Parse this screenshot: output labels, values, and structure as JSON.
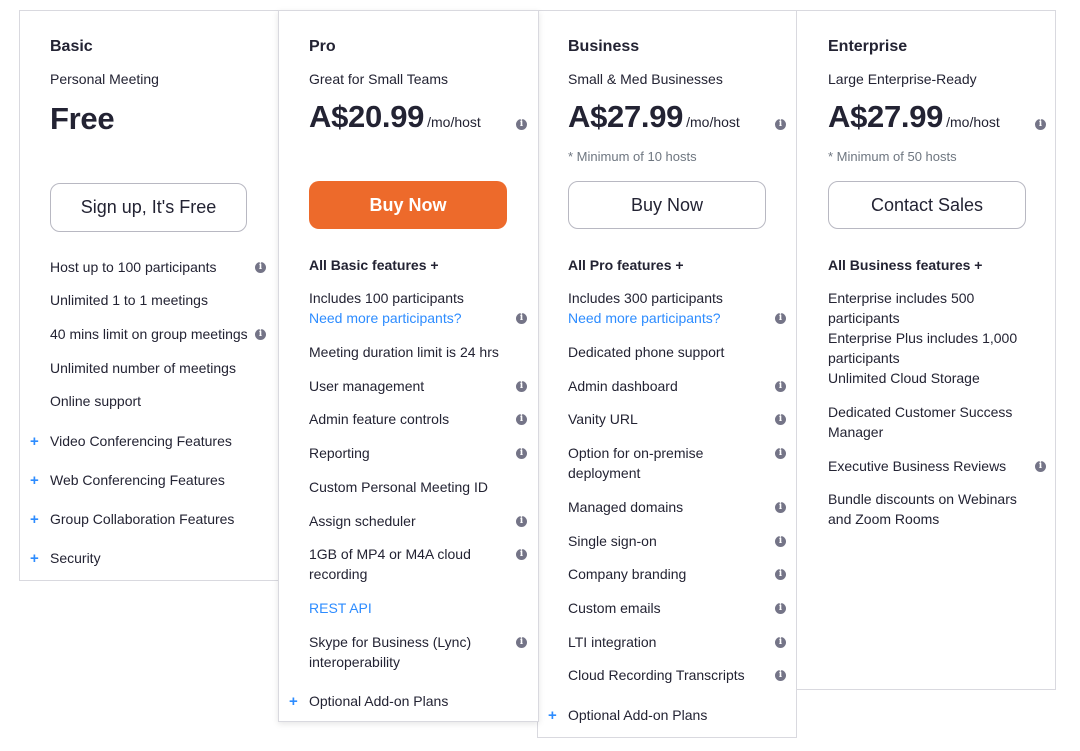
{
  "plans": {
    "basic": {
      "name": "Basic",
      "tagline": "Personal Meeting",
      "price": "Free",
      "button": "Sign up, It's Free",
      "features": [
        "Host up to 100 participants",
        "Unlimited 1 to 1 meetings",
        "40 mins limit on group meetings",
        "Unlimited number of meetings",
        "Online support"
      ],
      "expandables": [
        "Video Conferencing Features",
        "Web Conferencing Features",
        "Group Collaboration Features",
        "Security"
      ]
    },
    "pro": {
      "name": "Pro",
      "tagline": "Great for Small Teams",
      "price": "A$20.99",
      "price_unit": "/mo/host",
      "button": "Buy Now",
      "features_header": "All Basic features +",
      "features": {
        "participants": "Includes 100 participants",
        "need_more": "Need more participants?",
        "duration": "Meeting duration limit is 24 hrs",
        "user_mgmt": "User management",
        "admin_controls": "Admin feature controls",
        "reporting": "Reporting",
        "custom_id": "Custom Personal Meeting ID",
        "scheduler": "Assign scheduler",
        "cloud_line1": "1GB of MP4 or M4A cloud",
        "cloud_line2": "recording",
        "rest_api": "REST API",
        "skype_line1": "Skype for Business (Lync)",
        "skype_line2": "interoperability"
      },
      "addon": "Optional Add-on Plans"
    },
    "business": {
      "name": "Business",
      "tagline": "Small & Med Businesses",
      "price": "A$27.99",
      "price_unit": "/mo/host",
      "min_hosts": "* Minimum of 10 hosts",
      "button": "Buy Now",
      "features_header": "All Pro features +",
      "features": {
        "participants": "Includes 300 participants",
        "need_more": "Need more participants?",
        "phone_support": "Dedicated phone support",
        "admin_dashboard": "Admin dashboard",
        "vanity_url": "Vanity URL",
        "onprem_line1": "Option for on-premise",
        "onprem_line2": "deployment",
        "managed_domains": "Managed domains",
        "sso": "Single sign-on",
        "branding": "Company branding",
        "custom_emails": "Custom emails",
        "lti": "LTI integration",
        "transcripts": "Cloud Recording Transcripts"
      },
      "addon": "Optional Add-on Plans"
    },
    "enterprise": {
      "name": "Enterprise",
      "tagline": "Large Enterprise-Ready",
      "price": "A$27.99",
      "price_unit": "/mo/host",
      "min_hosts": "* Minimum of 50 hosts",
      "button": "Contact Sales",
      "features_header": "All Business features +",
      "features": {
        "ent_line1": "Enterprise includes 500",
        "ent_line2": "participants",
        "entplus_line1": "Enterprise Plus includes 1,000",
        "entplus_line2": "participants",
        "storage": "Unlimited Cloud Storage",
        "csm_line1": "Dedicated Customer Success",
        "csm_line2": "Manager",
        "reviews": "Executive Business Reviews",
        "bundle_line1": "Bundle discounts on Webinars",
        "bundle_line2": "and Zoom Rooms"
      }
    }
  },
  "icons": {
    "info": "info-icon",
    "plus": "plus-icon",
    "info_glyph": "i",
    "plus_glyph": "+"
  },
  "colors": {
    "primary_button": "#ed6a2b",
    "link": "#2d8cff",
    "text": "#232333",
    "muted": "#6e7680",
    "info_icon": "#747487",
    "border": "#d9d9df"
  }
}
